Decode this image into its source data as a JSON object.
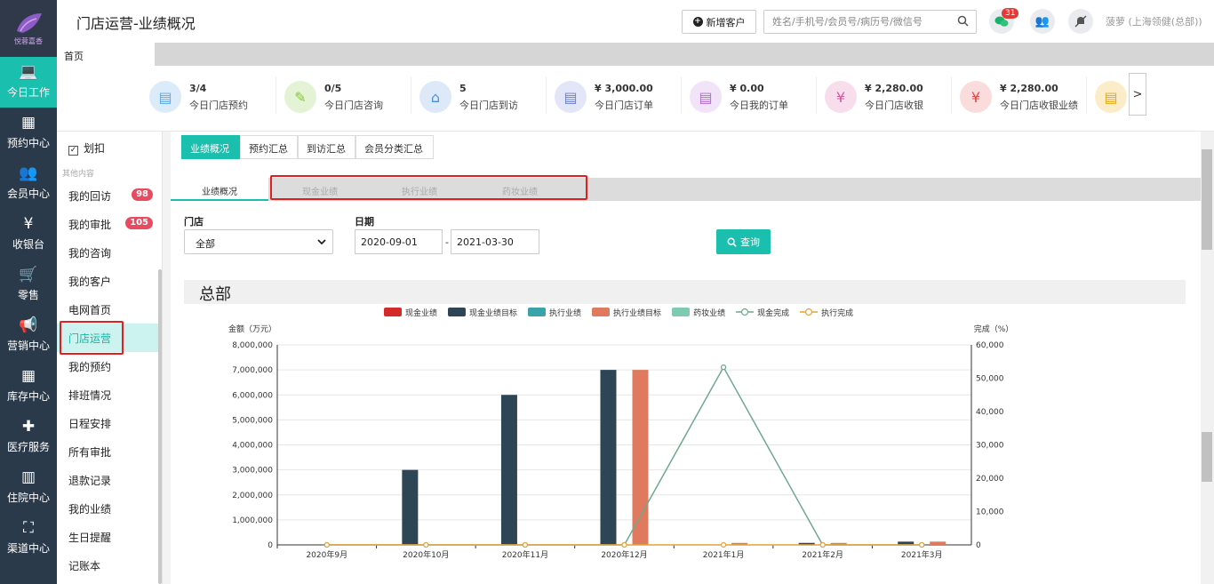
{
  "app": {
    "logo_text": "悦蓉嘉香",
    "page_title": "门店运营-业绩概况"
  },
  "nav": [
    {
      "label": "今日工作",
      "icon": "laptop-icon",
      "glyph": "💻",
      "active": true
    },
    {
      "label": "预约中心",
      "icon": "calendar-icon",
      "glyph": "▦",
      "active": false
    },
    {
      "label": "会员中心",
      "icon": "members-icon",
      "glyph": "👥",
      "active": false
    },
    {
      "label": "收银台",
      "icon": "yen-icon",
      "glyph": "¥",
      "active": false
    },
    {
      "label": "零售",
      "icon": "cart-icon",
      "glyph": "🛒",
      "active": false
    },
    {
      "label": "营销中心",
      "icon": "megaphone-icon",
      "glyph": "📢",
      "active": false
    },
    {
      "label": "库存中心",
      "icon": "grid-icon",
      "glyph": "▦",
      "active": false
    },
    {
      "label": "医疗服务",
      "icon": "medkit-icon",
      "glyph": "✚",
      "active": false
    },
    {
      "label": "住院中心",
      "icon": "building-icon",
      "glyph": "▥",
      "active": false
    },
    {
      "label": "渠道中心",
      "icon": "sitemap-icon",
      "glyph": "⛶",
      "active": false
    }
  ],
  "header": {
    "new_customer": "新增客户",
    "search_placeholder": "姓名/手机号/会员号/病历号/微信号",
    "message_count": "31",
    "user": "菠萝 (上海领健(总部))"
  },
  "tabs": {
    "home": "首页"
  },
  "stats": [
    {
      "value": "3/4",
      "label": "今日门店预约",
      "icon": "appointment-icon",
      "glyph": "▤",
      "color": "#5aa9e6",
      "bg": "#dcebfa"
    },
    {
      "value": "0/5",
      "label": "今日门店咨询",
      "icon": "consult-icon",
      "glyph": "✎",
      "color": "#8bc34a",
      "bg": "#e4f3d5"
    },
    {
      "value": "5",
      "label": "今日门店到访",
      "icon": "store-icon",
      "glyph": "⌂",
      "color": "#4a90d9",
      "bg": "#dde9f8"
    },
    {
      "value": "¥ 3,000.00",
      "label": "今日门店订单",
      "icon": "order-icon",
      "glyph": "▤",
      "color": "#6b7fd0",
      "bg": "#e3e6f7"
    },
    {
      "value": "¥ 0.00",
      "label": "今日我的订单",
      "icon": "my-order-icon",
      "glyph": "▤",
      "color": "#b06ad0",
      "bg": "#f1e3f8"
    },
    {
      "value": "¥ 2,280.00",
      "label": "今日门店收银",
      "icon": "cash-icon",
      "glyph": "¥",
      "color": "#d05aa0",
      "bg": "#f8dded"
    },
    {
      "value": "¥ 2,280.00",
      "label": "今日门店收银业绩",
      "icon": "cash-perf-icon",
      "glyph": "¥",
      "color": "#e04848",
      "bg": "#fadcdc"
    },
    {
      "value": "",
      "label": "",
      "icon": "clipboard-icon",
      "glyph": "▤",
      "color": "#e6a817",
      "bg": "#fbedc9"
    }
  ],
  "more_label": ">",
  "submenu": {
    "top_item": "划扣",
    "group_label": "其他内容",
    "items": [
      {
        "label": "我的回访",
        "badge": "98"
      },
      {
        "label": "我的审批",
        "badge": "105"
      },
      {
        "label": "我的咨询",
        "badge": ""
      },
      {
        "label": "我的客户",
        "badge": ""
      },
      {
        "label": "电网首页",
        "badge": ""
      },
      {
        "label": "门店运营",
        "badge": "",
        "active": true
      },
      {
        "label": "我的预约",
        "badge": ""
      },
      {
        "label": "排班情况",
        "badge": ""
      },
      {
        "label": "日程安排",
        "badge": ""
      },
      {
        "label": "所有审批",
        "badge": ""
      },
      {
        "label": "退款记录",
        "badge": ""
      },
      {
        "label": "我的业绩",
        "badge": ""
      },
      {
        "label": "生日提醒",
        "badge": ""
      },
      {
        "label": "记账本",
        "badge": ""
      }
    ]
  },
  "content": {
    "tabs": [
      "业绩概况",
      "预约汇总",
      "到访汇总",
      "会员分类汇总"
    ],
    "subtabs": [
      "业绩概况",
      "现金业绩",
      "执行业绩",
      "药妆业绩"
    ],
    "filter": {
      "store_label": "门店",
      "store_value": "全部",
      "date_label": "日期",
      "date_from": "2020-09-01",
      "date_to": "2021-03-30",
      "date_sep": "-",
      "query_button": "查询"
    },
    "section_title": "总部"
  },
  "chart_data": {
    "type": "bar",
    "categories": [
      "2020年9月",
      "2020年10月",
      "2020年11月",
      "2020年12月",
      "2021年1月",
      "2021年2月",
      "2021年3月"
    ],
    "ylabel": "金额（万元）",
    "y2label": "完成（%）",
    "ylim": [
      0,
      8000000
    ],
    "y2lim": [
      0,
      60000
    ],
    "yticks": [
      "0",
      "1,000,000",
      "2,000,000",
      "3,000,000",
      "4,000,000",
      "5,000,000",
      "6,000,000",
      "7,000,000",
      "8,000,000"
    ],
    "y2ticks": [
      "0",
      "10,000",
      "20,000",
      "30,000",
      "40,000",
      "50,000",
      "60,000"
    ],
    "legend": [
      "现金业绩",
      "现金业绩目标",
      "执行业绩",
      "执行业绩目标",
      "药妆业绩",
      "现金完成",
      "执行完成"
    ],
    "series": [
      {
        "name": "现金业绩",
        "kind": "bar",
        "color": "#d42a2a",
        "values": [
          0,
          0,
          0,
          0,
          0,
          0,
          0
        ]
      },
      {
        "name": "现金业绩目标",
        "kind": "bar",
        "color": "#2d4554",
        "values": [
          0,
          3000000,
          6000000,
          7000000,
          0,
          80000,
          130000
        ]
      },
      {
        "name": "执行业绩",
        "kind": "bar",
        "color": "#3aa3aa",
        "values": [
          0,
          0,
          0,
          0,
          0,
          0,
          0
        ]
      },
      {
        "name": "执行业绩目标",
        "kind": "bar",
        "color": "#e07a5f",
        "values": [
          0,
          0,
          0,
          7000000,
          80000,
          80000,
          130000
        ]
      },
      {
        "name": "药妆业绩",
        "kind": "bar",
        "color": "#7fcbaf",
        "values": [
          0,
          0,
          0,
          0,
          0,
          0,
          0
        ]
      },
      {
        "name": "现金完成",
        "kind": "line",
        "axis": "right",
        "color": "#6fa88e",
        "values": [
          0,
          0,
          0,
          0,
          53300,
          0,
          0
        ]
      },
      {
        "name": "执行完成",
        "kind": "line",
        "axis": "right",
        "color": "#e3a33a",
        "values": [
          0,
          0,
          0,
          0,
          0,
          0,
          0
        ]
      }
    ],
    "grid": true,
    "legend_position": "top"
  }
}
